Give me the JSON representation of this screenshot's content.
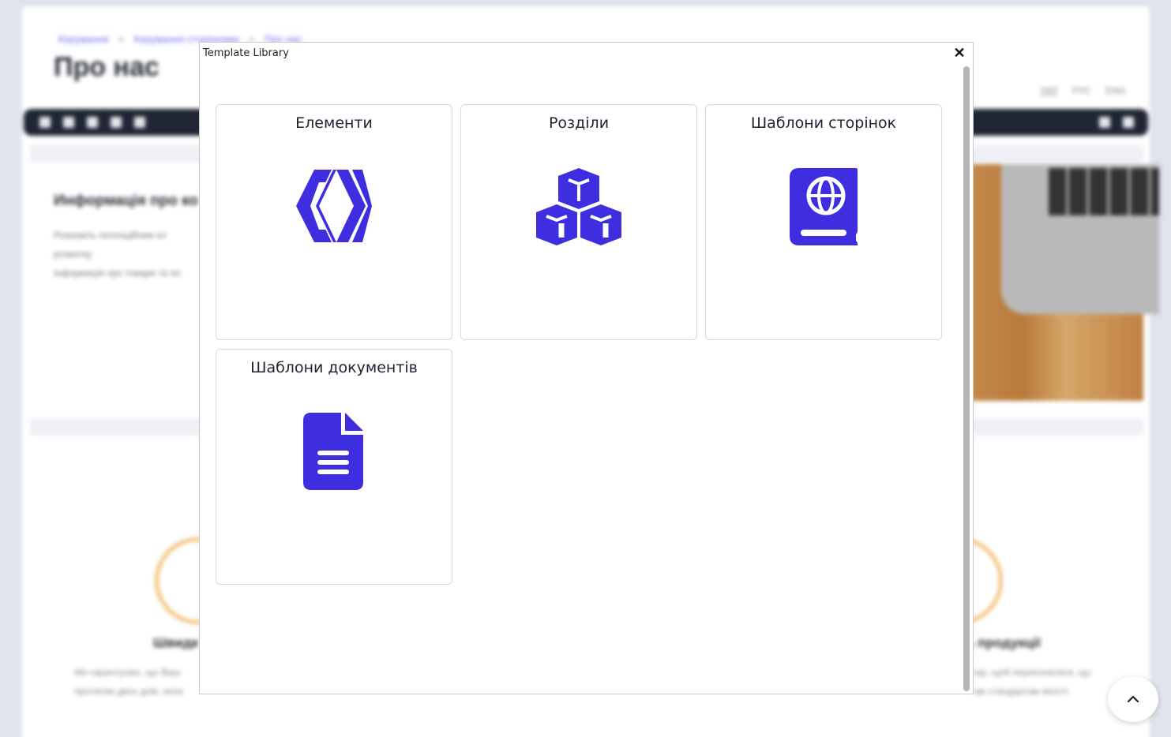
{
  "background": {
    "breadcrumb": [
      "Керування",
      "Керування сторінками",
      "Про нас"
    ],
    "breadcrumb_sep": ">",
    "page_title": "Про нас",
    "languages": [
      "УКР",
      "РУС",
      "ENG"
    ],
    "section_title": "Информація про ко",
    "section_text": [
      "Розкажіть потенційним кл",
      "розвитку",
      "Інформація про товари та по"
    ],
    "feature_left_title": "Швидк",
    "feature_right_title": "ь продукції",
    "feature_left_text": [
      "Ми гарантуємо, що Ваш",
      "протягом двох днів, неза"
    ],
    "feature_right_text": [
      "іар, щоб переконатися, що",
      "ам стандартам якості."
    ]
  },
  "modal": {
    "title": "Template Library",
    "close_icon": "close-icon",
    "cards": [
      {
        "label": "Елементи",
        "icon": "hive-logo-icon",
        "color": "#3f2ee0"
      },
      {
        "label": "Розділи",
        "icon": "cubes-icon",
        "color": "#3f2ee0"
      },
      {
        "label": "Шаблони сторінок",
        "icon": "atlas-book-icon",
        "color": "#3f2ee0"
      },
      {
        "label": "Шаблони документів",
        "icon": "document-icon",
        "color": "#3f2ee0"
      }
    ]
  },
  "scroll_top": {
    "icon": "chevron-up-icon"
  }
}
